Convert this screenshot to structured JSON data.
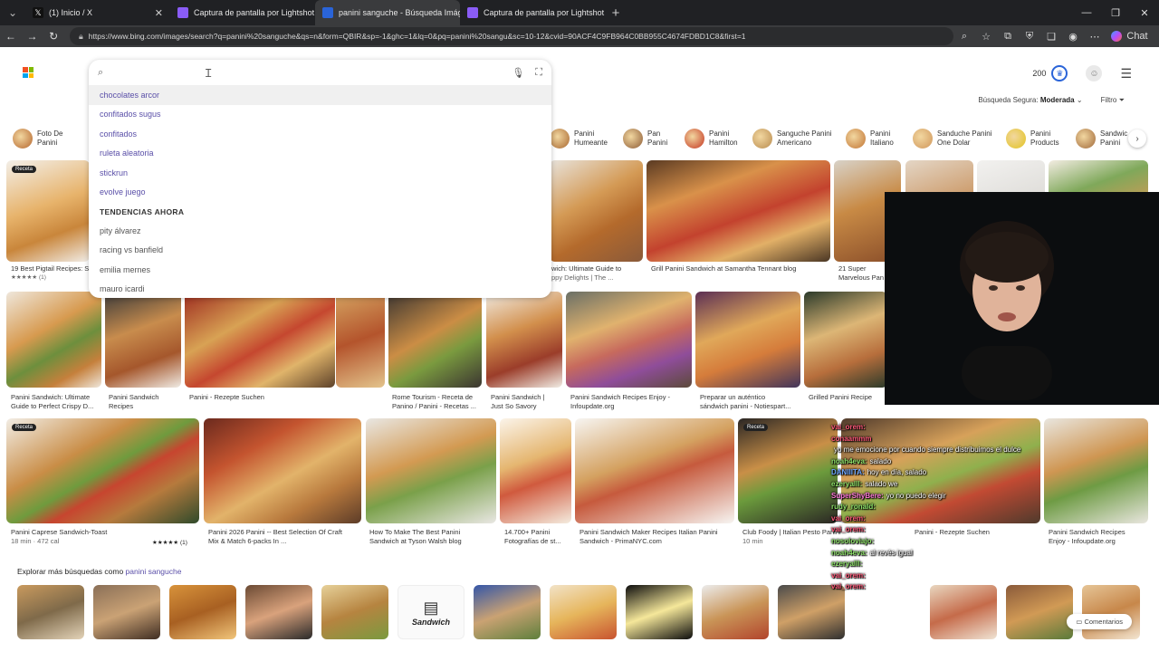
{
  "browser": {
    "tabs": [
      {
        "label": "(1) Inicio / X",
        "fav": "#111111"
      },
      {
        "label": "Captura de pantalla por Lightshot",
        "fav": "#8a5cf6"
      },
      {
        "label": "panini sanguche - Búsqueda Imág",
        "fav": "#2a64d8",
        "active": true
      },
      {
        "label": "Captura de pantalla por Lightshot",
        "fav": "#8a5cf6"
      }
    ],
    "url": "https://www.bing.com/images/search?q=panini%20sanguche&qs=n&form=QBIR&sp=-1&ghc=1&lq=0&pq=panini%20sangu&sc=10-12&cvid=90ACF4C9FB964C0BB955C4674FDBD1C8&first=1",
    "chat_label": "Chat"
  },
  "header": {
    "points": "200",
    "safe_search_label": "Búsqueda Segura:",
    "safe_search_value": "Moderada",
    "filter_label": "Filtro"
  },
  "search": {
    "value": "",
    "suggestions": [
      "chocolates arcor",
      "confitados sugus",
      "confitados",
      "ruleta aleatoria",
      "stickrun",
      "evolve juego"
    ],
    "trending_heading": "TENDENCIAS AHORA",
    "trending": [
      "pity álvarez",
      "racing vs banfield",
      "emilia mernes",
      "mauro icardi"
    ]
  },
  "related": [
    {
      "l1": "Foto De",
      "l2": "Panini",
      "c": "#b5652d"
    },
    {
      "l1": "Panini",
      "l2": "Humeante",
      "c": "#a8662e"
    },
    {
      "l1": "Pan",
      "l2": "Panini",
      "c": "#8c5a34"
    },
    {
      "l1": "Panini",
      "l2": "Hamilton",
      "c": "#c4331f"
    },
    {
      "l1": "Sanguche Panini",
      "l2": "Americano",
      "c": "#b98b4e"
    },
    {
      "l1": "Panini",
      "l2": "Italiano",
      "c": "#c27433"
    },
    {
      "l1": "Sanduche Panini",
      "l2": "One Dolar",
      "c": "#d0965a"
    },
    {
      "l1": "Panini",
      "l2": "Products",
      "c": "#e2c31f"
    },
    {
      "l1": "Sandwic",
      "l2": "Panini",
      "c": "#a0683a"
    }
  ],
  "row1_captions": [
    {
      "t": "19 Best Pigtail Recipes: S",
      "s": "★★★★★ (1)"
    },
    {
      "t": "wich: Ultimate Guide to",
      "s": "ppy Delights | The ..."
    },
    {
      "t": "Grill Panini Sandwich at Samantha Tennant blog",
      "s": ""
    },
    {
      "t": "21 Super",
      "s": "Marvelous Pan"
    }
  ],
  "row2_captions": [
    {
      "t": "Panini Sandwich: Ultimate",
      "s": "Guide to Perfect Crispy D..."
    },
    {
      "t": "Panini Sandwich",
      "s": "Recipes"
    },
    {
      "t": "Panini - Rezepte Suchen",
      "s": ""
    },
    {
      "t": "Rome Tourism - Receta de",
      "s": "Panino / Panini - Recetas ..."
    },
    {
      "t": "Panini Sandwich |",
      "s": "Just So Savory"
    },
    {
      "t": "Panini Sandwich Recipes Enjoy -",
      "s": "Infoupdate.org"
    },
    {
      "t": "Preparar un auténtico",
      "s": "sándwich panini - Notiespart..."
    },
    {
      "t": "Grilled Panini Recipe",
      "s": ""
    }
  ],
  "row3_captions": [
    {
      "t": "Panini Caprese Sandwich-Toast",
      "s": "18 min · 472 cal"
    },
    {
      "t": "Panini 2026 Panini -- Best Selection Of Craft",
      "s": "Mix & Match 6-packs In ..."
    },
    {
      "t": "How To Make The Best Panini",
      "s": "Sandwich at Tyson Walsh blog"
    },
    {
      "t": "14.700+ Panini",
      "s": "Fotografías de st..."
    },
    {
      "t": "Panini Sandwich Maker Recipes Italian Panini",
      "s": "Sandwich - PrimaNYC.com"
    },
    {
      "t": "Club Foody | Italian Pesto Panini",
      "s": "10 min"
    },
    {
      "t": "Panini - Rezepte Suchen",
      "s": ""
    },
    {
      "t": "Panini Sandwich Recipes",
      "s": "Enjoy - Infoupdate.org"
    }
  ],
  "row3_rating": "★★★★★ (1)",
  "recipe_badge": "Receta",
  "explore": {
    "prefix": "Explorar más búsquedas como",
    "term": "panini sanguche"
  },
  "explore_logo_text": "Sandwich",
  "feedback_label": "Comentarios",
  "chat_messages": [
    {
      "user": "vai_orem:",
      "msg": "",
      "color": "#ff5a7a"
    },
    {
      "user": "conaammm",
      "msg": "",
      "color": "#ff5a7a"
    },
    {
      "user": "",
      "msg": "yo me emocione por cuando siempre distribuimos el dulce",
      "color": "#ffffff"
    },
    {
      "user": "noah4eva:",
      "msg": "salado",
      "color": "#8fe36a"
    },
    {
      "user": "DANIIITA:",
      "msg": "hoy en día, salado",
      "color": "#6fa8ff"
    },
    {
      "user": "ezeryalll:",
      "msg": "salado we",
      "color": "#8fe36a"
    },
    {
      "user": "SuperShyBere:",
      "msg": "yo no puedo elegir",
      "color": "#ff7ad9"
    },
    {
      "user": "rudy_ronald:",
      "msg": "",
      "color": "#8fe36a"
    },
    {
      "user": "vai_orem:",
      "msg": "",
      "color": "#ff5a7a"
    },
    {
      "user": "vai_orem:",
      "msg": "",
      "color": "#ff5a7a"
    },
    {
      "user": "nosoloviajo:",
      "msg": "",
      "color": "#8fe36a"
    },
    {
      "user": "noah4eva:",
      "msg": "al revés igual",
      "color": "#8fe36a"
    },
    {
      "user": "ezeryalll:",
      "msg": "",
      "color": "#8fe36a"
    },
    {
      "user": "vai_orem:",
      "msg": "",
      "color": "#ff5a7a"
    },
    {
      "user": "vai_orem:",
      "msg": "",
      "color": "#ff5a7a"
    }
  ]
}
